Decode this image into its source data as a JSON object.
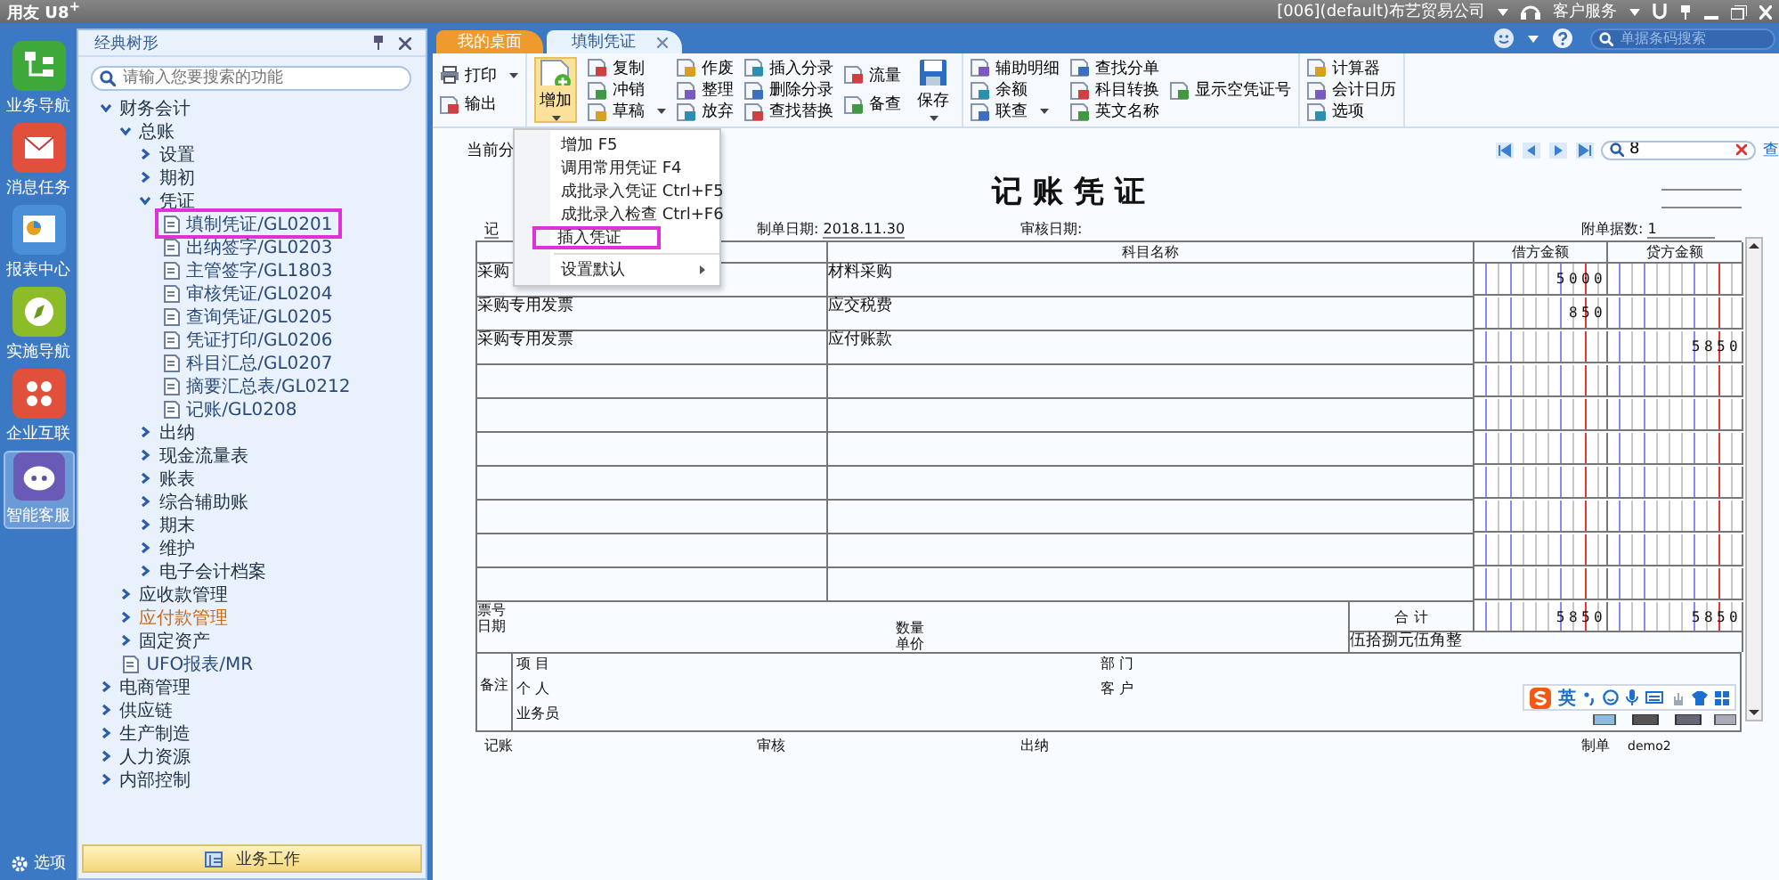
{
  "title_bar": {
    "logo": "用友 U8$^{+}$",
    "company": "[006](default)布艺贸易公司",
    "service": "客户服务"
  },
  "nav": [
    {
      "label": "业务导航",
      "selected": false
    },
    {
      "label": "消息任务",
      "selected": false
    },
    {
      "label": "报表中心",
      "selected": false
    },
    {
      "label": "实施导航",
      "selected": false
    },
    {
      "label": "企业互联",
      "selected": false
    },
    {
      "label": "智能客服",
      "selected": true
    }
  ],
  "nav_options": "选项",
  "sidebar": {
    "title": "经典树形",
    "search": {
      "placeholder": "请输入您要搜索的功能"
    },
    "tree": [
      {
        "label": "财务会计",
        "kind": "folder",
        "expanded": true,
        "children": [
          {
            "label": "总账",
            "kind": "folder",
            "expanded": true,
            "children": [
              {
                "label": "设置",
                "kind": "folder",
                "expanded": false
              },
              {
                "label": "期初",
                "kind": "folder",
                "expanded": false
              },
              {
                "label": "凭证",
                "kind": "folder",
                "expanded": true,
                "children": [
                  {
                    "label": "填制凭证/GL0201",
                    "kind": "doc",
                    "highlighted": true
                  },
                  {
                    "label": "出纳签字/GL0203",
                    "kind": "doc",
                    "highlighted": false
                  },
                  {
                    "label": "主管签字/GL1803",
                    "kind": "doc",
                    "highlighted": false
                  },
                  {
                    "label": "审核凭证/GL0204",
                    "kind": "doc",
                    "highlighted": false
                  },
                  {
                    "label": "查询凭证/GL0205",
                    "kind": "doc",
                    "highlighted": false
                  },
                  {
                    "label": "凭证打印/GL0206",
                    "kind": "doc",
                    "highlighted": false
                  },
                  {
                    "label": "科目汇总/GL0207",
                    "kind": "doc",
                    "highlighted": false
                  },
                  {
                    "label": "摘要汇总表/GL0212",
                    "kind": "doc",
                    "highlighted": false
                  },
                  {
                    "label": "记账/GL0208",
                    "kind": "doc",
                    "highlighted": false
                  }
                ]
              },
              {
                "label": "出纳",
                "kind": "folder",
                "expanded": false
              },
              {
                "label": "现金流量表",
                "kind": "folder",
                "expanded": false
              },
              {
                "label": "账表",
                "kind": "folder",
                "expanded": false
              },
              {
                "label": "综合辅助账",
                "kind": "folder",
                "expanded": false
              },
              {
                "label": "期末",
                "kind": "folder",
                "expanded": false
              },
              {
                "label": "维护",
                "kind": "folder",
                "expanded": false
              },
              {
                "label": "电子会计档案",
                "kind": "folder",
                "expanded": false
              }
            ]
          },
          {
            "label": "应收款管理",
            "kind": "folder",
            "expanded": false
          },
          {
            "label": "应付款管理",
            "kind": "folder",
            "expanded": false,
            "color": "#c86a1e"
          },
          {
            "label": "固定资产",
            "kind": "folder",
            "expanded": false
          },
          {
            "label": "UFO报表/MR",
            "kind": "doc",
            "highlighted": false
          }
        ]
      },
      {
        "label": "电商管理",
        "kind": "folder",
        "expanded": false
      },
      {
        "label": "供应链",
        "kind": "folder",
        "expanded": false
      },
      {
        "label": "生产制造",
        "kind": "folder",
        "expanded": false
      },
      {
        "label": "人力资源",
        "kind": "folder",
        "expanded": false
      },
      {
        "label": "内部控制",
        "kind": "folder",
        "expanded": false
      }
    ],
    "footer": "业务工作"
  },
  "tabs": [
    {
      "label": "我的桌面",
      "selected": false,
      "closable": false
    },
    {
      "label": "填制凭证",
      "selected": true,
      "closable": true
    }
  ],
  "barcode_search": {
    "placeholder": "单据条码搜索"
  },
  "toolbar": [
    {
      "columns": [
        {
          "kind": "stack",
          "items": [
            {
              "label": "打印",
              "dropdown": true
            },
            {
              "label": "输出",
              "dropdown": false
            }
          ]
        }
      ]
    },
    {
      "columns": [
        {
          "kind": "large",
          "label": "增加",
          "dropdown": true,
          "pressed": true
        },
        {
          "kind": "stack",
          "items": [
            {
              "label": "复制",
              "dropdown": false
            },
            {
              "label": "冲销",
              "dropdown": false
            },
            {
              "label": "草稿",
              "dropdown": true
            }
          ]
        },
        {
          "kind": "stack",
          "items": [
            {
              "label": "作废",
              "dropdown": false
            },
            {
              "label": "整理",
              "dropdown": false
            },
            {
              "label": "放弃",
              "dropdown": false
            }
          ]
        },
        {
          "kind": "stack",
          "items": [
            {
              "label": "插入分录",
              "dropdown": false
            },
            {
              "label": "删除分录",
              "dropdown": false
            },
            {
              "label": "查找替换",
              "dropdown": false
            }
          ]
        },
        {
          "kind": "stack",
          "items": [
            {
              "label": "流量",
              "dropdown": false
            },
            {
              "label": "备查",
              "dropdown": false
            }
          ]
        },
        {
          "kind": "large",
          "label": "保存",
          "dropdown": true,
          "pressed": false
        }
      ]
    },
    {
      "columns": [
        {
          "kind": "stack",
          "items": [
            {
              "label": "辅助明细",
              "dropdown": false
            },
            {
              "label": "余额",
              "dropdown": false
            },
            {
              "label": "联查",
              "dropdown": true
            }
          ]
        },
        {
          "kind": "stack",
          "items": [
            {
              "label": "查找分单",
              "dropdown": false
            },
            {
              "label": "科目转换",
              "dropdown": false
            },
            {
              "label": "英文名称",
              "dropdown": false
            }
          ]
        },
        {
          "kind": "stack",
          "items": [
            {
              "label": "显示空凭证号",
              "dropdown": false
            }
          ]
        }
      ]
    },
    {
      "columns": [
        {
          "kind": "stack",
          "items": [
            {
              "label": "计算器",
              "dropdown": false
            },
            {
              "label": "会计日历",
              "dropdown": false
            },
            {
              "label": "选项",
              "dropdown": false
            }
          ]
        }
      ]
    }
  ],
  "menu": {
    "items": [
      {
        "label": "增加",
        "shortcut": "F5",
        "kind": "command",
        "highlighted": false
      },
      {
        "label": "调用常用凭证",
        "shortcut": "F4",
        "kind": "command",
        "highlighted": false
      },
      {
        "label": "成批录入凭证",
        "shortcut": "Ctrl+F5",
        "kind": "command",
        "highlighted": false
      },
      {
        "label": "成批录入检查",
        "shortcut": "Ctrl+F6",
        "kind": "command",
        "highlighted": false
      },
      {
        "label": "插入凭证",
        "kind": "command",
        "highlighted": true
      },
      {
        "label": "设置默认",
        "kind": "submenu",
        "highlighted": false
      }
    ]
  },
  "voucher": {
    "current_prefix": "当前分",
    "search": {
      "value": "8"
    },
    "query_link": "查",
    "title": "记 账 凭 证",
    "type_label": "记",
    "made_date_label": "制单日期:",
    "made_date": "2018.11.30",
    "audit_date_label": "审核日期:",
    "attachments_label": "附单据数:",
    "attachments": "1",
    "columns": {
      "account": "科目名称",
      "debit": "借方金额",
      "credit": "贷方金额"
    },
    "rows": [
      {
        "summary": "采购",
        "account": "材料采购",
        "debit": "5000"
      },
      {
        "summary": "采购专用发票",
        "account": "应交税费",
        "debit": "850"
      },
      {
        "summary": "采购专用发票",
        "account": "应付账款",
        "credit": "5850"
      }
    ],
    "ticket_label": "票号",
    "date_label": "日期",
    "qty_label": "数量",
    "price_label": "单价",
    "total_label": "合 计",
    "total_debit": "5850",
    "total_credit": "5850",
    "amount_words": "伍拾捌元伍角整",
    "remark_label": "备注",
    "remark_left": [
      "项 目",
      "个 人",
      "业务员"
    ],
    "remark_right": [
      "部 门",
      "客 户"
    ],
    "signatures": [
      {
        "label": "记账"
      },
      {
        "label": "审核"
      },
      {
        "label": "出纳"
      },
      {
        "label": "制单",
        "value": "demo2"
      }
    ]
  },
  "ime": {
    "mode": "英"
  }
}
